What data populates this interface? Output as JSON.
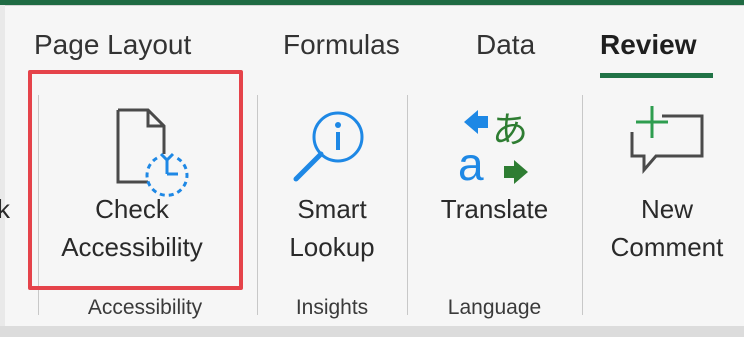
{
  "tabs": [
    {
      "label": "Page Layout"
    },
    {
      "label": "Formulas"
    },
    {
      "label": "Data"
    },
    {
      "label": "Review"
    }
  ],
  "clipped_left_text": "k",
  "buttons": {
    "check_accessibility": {
      "line1": "Check",
      "line2": "Accessibility",
      "icon": "check-accessibility-icon"
    },
    "smart_lookup": {
      "line1": "Smart",
      "line2": "Lookup",
      "icon": "smart-lookup-icon"
    },
    "translate": {
      "line1": "Translate",
      "icon": "translate-icon",
      "glyph_a": "a",
      "glyph_kana": "あ"
    },
    "new_comment": {
      "line1": "New",
      "line2": "Comment",
      "icon": "new-comment-icon"
    }
  },
  "groups": {
    "accessibility": "Accessibility",
    "insights": "Insights",
    "language": "Language"
  },
  "colors": {
    "accent_green": "#217346",
    "highlight_red": "#e5434a",
    "icon_blue": "#1e88e5"
  }
}
